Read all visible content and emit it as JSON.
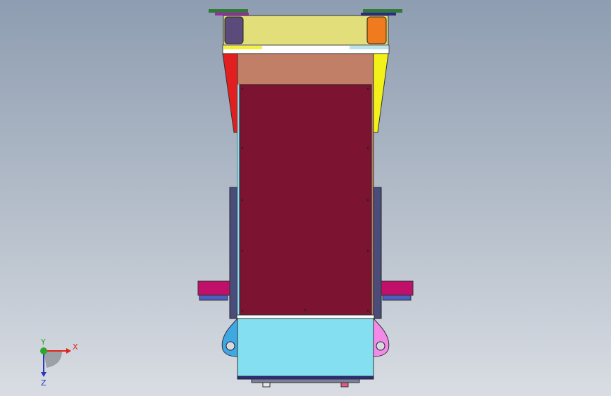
{
  "viewport": {
    "background_top": "#8e9db1",
    "background_bottom": "#d9dde3"
  },
  "model": {
    "colors": {
      "top_beam": "#e2df7a",
      "left_cap": "#5a4b7a",
      "right_cap": "#f07a1e",
      "top_plate_white": "#ffffff",
      "yellow_strip": "#f5f03c",
      "light_cyan_strip": "#b9e4ee",
      "salmon_panel": "#c07f66",
      "red_gusset": "#e21f1f",
      "yellow_gusset": "#f2f21a",
      "maroon_panel": "#7c1330",
      "side_rail": "#4a4d7a",
      "cyan_block": "#84e0f1",
      "magenta_pad": "#c0106a",
      "blue_ear": "#3ea7e4",
      "pink_ear": "#f28ae8",
      "bottom_edge": "#2b2a88",
      "green_tab": "#2f7a3a",
      "purple_tab": "#9a2aa8"
    }
  },
  "triad": {
    "x_label": "X",
    "y_label": "Y",
    "z_label": "Z",
    "x_color": "#e0241c",
    "y_color": "#2ea62e",
    "z_color": "#2a36c4"
  }
}
